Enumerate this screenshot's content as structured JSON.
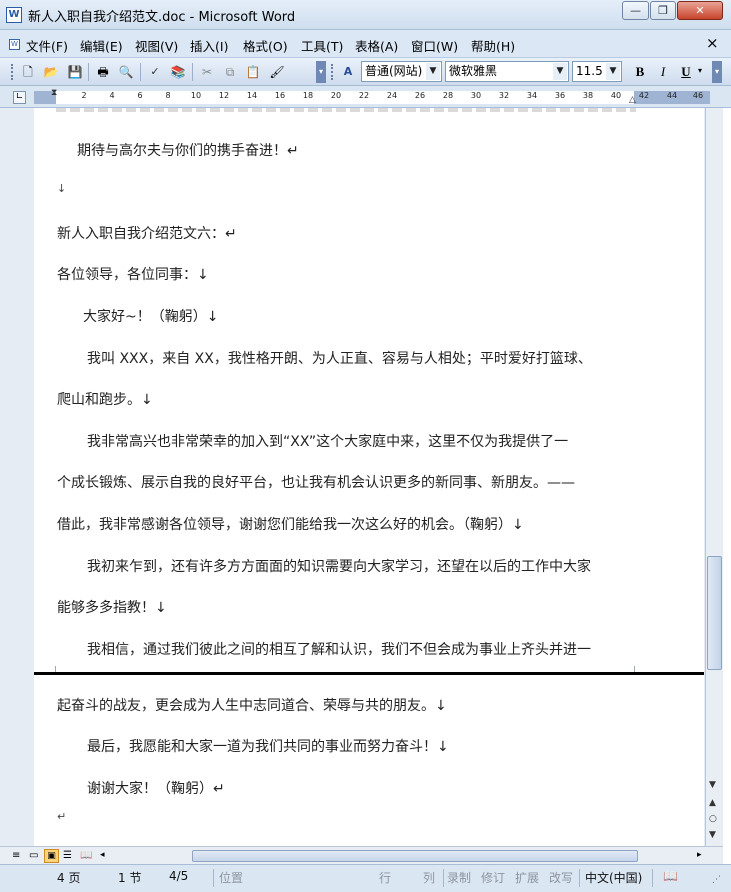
{
  "window": {
    "title": "新人入职自我介绍范文.doc - Microsoft Word",
    "minimize": "—",
    "restore": "❐",
    "close": "✕"
  },
  "menu": {
    "items": [
      "文件(F)",
      "编辑(E)",
      "视图(V)",
      "插入(I)",
      "格式(O)",
      "工具(T)",
      "表格(A)",
      "窗口(W)",
      "帮助(H)"
    ],
    "close": "×"
  },
  "toolbar": {
    "style_value": "普通(网站)",
    "font_value": "微软雅黑",
    "size_value": "11.5",
    "bold": "B",
    "italic": "I",
    "underline": "U"
  },
  "ruler": {
    "ticks": [
      "2",
      "4",
      "6",
      "8",
      "10",
      "12",
      "14",
      "16",
      "18",
      "20",
      "22",
      "24",
      "26",
      "28",
      "30",
      "32",
      "34",
      "36",
      "38",
      "40",
      "42",
      "44",
      "46"
    ]
  },
  "document": {
    "lines": [
      "期待与高尔夫与你们的携手奋进！↵",
      "↓",
      "新人入职自我介绍范文六：↵",
      "各位领导，各位同事：↓",
      "大家好~！（鞠躬）↓",
      "我叫 XXX，来自 XX，我性格开朗、为人正直、容易与人相处；平时爱好打篮球、",
      "爬山和跑步。↓",
      "我非常高兴也非常荣幸的加入到“XX”这个大家庭中来，这里不仅为我提供了一",
      "个成长锻炼、展示自我的良好平台，也让我有机会认识更多的新同事、新朋友。——",
      "借此，我非常感谢各位领导，谢谢您们能给我一次这么好的机会。（鞠躬）↓",
      "我初来乍到，还有许多方方面面的知识需要向大家学习，还望在以后的工作中大家",
      "能够多多指教！↓",
      "我相信，通过我们彼此之间的相互了解和认识，我们不但会成为事业上齐头并进一",
      "起奋斗的战友，更会成为人生中志同道合、荣辱与共的朋友。↓",
      "最后，我愿能和大家一道为我们共同的事业而努力奋斗！↓",
      "谢谢大家！（鞠躬）↵",
      "↵"
    ]
  },
  "statusbar": {
    "page": "4 页",
    "section": "1 节",
    "pages": "4/5",
    "position": "位置",
    "row": "行",
    "col": "列",
    "rec": "录制",
    "trk": "修订",
    "ext": "扩展",
    "ovr": "改写",
    "lang": "中文(中国)"
  }
}
